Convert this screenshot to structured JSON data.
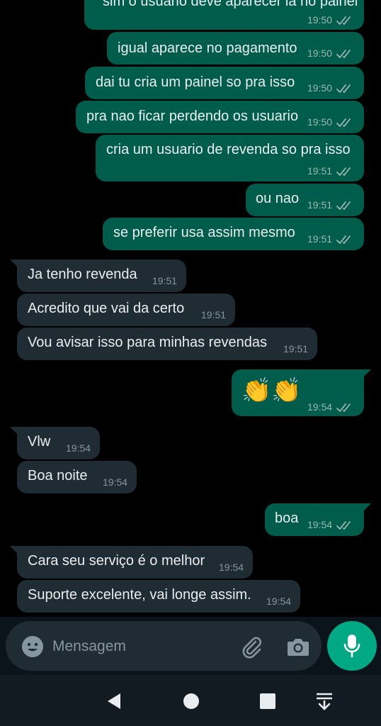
{
  "messages": [
    {
      "dir": "out",
      "text": "sim o usuario deve aparecer lá no painel",
      "time": "19:50"
    },
    {
      "dir": "out",
      "text": "igual aparece no pagamento",
      "time": "19:50"
    },
    {
      "dir": "out",
      "text": "dai tu cria um painel so pra isso",
      "time": "19:50"
    },
    {
      "dir": "out",
      "text": "pra nao ficar perdendo os usuario",
      "time": "19:50"
    },
    {
      "dir": "out",
      "text": "cria um usuario de revenda so pra isso",
      "time": "19:51"
    },
    {
      "dir": "out",
      "text": "ou nao",
      "time": "19:51"
    },
    {
      "dir": "out",
      "text": "se preferir usa assim mesmo",
      "time": "19:51"
    },
    {
      "dir": "in",
      "text": "Ja tenho revenda",
      "time": "19:51"
    },
    {
      "dir": "in",
      "text": "Acredito que vai da certo",
      "time": "19:51"
    },
    {
      "dir": "in",
      "text": "Vou avisar isso para minhas revendas",
      "time": "19:51"
    },
    {
      "dir": "out",
      "text": "👏👏",
      "time": "19:54"
    },
    {
      "dir": "in",
      "text": "Vlw",
      "time": "19:54"
    },
    {
      "dir": "in",
      "text": "Boa noite",
      "time": "19:54"
    },
    {
      "dir": "out",
      "text": "boa",
      "time": "19:54"
    },
    {
      "dir": "in",
      "text": "Cara seu serviço é o melhor",
      "time": "19:54"
    },
    {
      "dir": "in",
      "text": "Suporte excelente, vai longe assim.",
      "time": "19:54"
    }
  ],
  "composer": {
    "placeholder": "Mensagem",
    "icons": [
      "emoji-icon",
      "paperclip-icon",
      "camera-icon",
      "microphone-icon"
    ]
  },
  "navbar": {
    "icons": [
      "back-icon",
      "home-icon",
      "recents-icon",
      "notifications-down-icon"
    ]
  },
  "colors": {
    "outgoing_bubble": "#005c4b",
    "incoming_bubble": "#202c33",
    "accent": "#00a884",
    "background": "#000000",
    "read_ticks": "#9fb7b0"
  }
}
